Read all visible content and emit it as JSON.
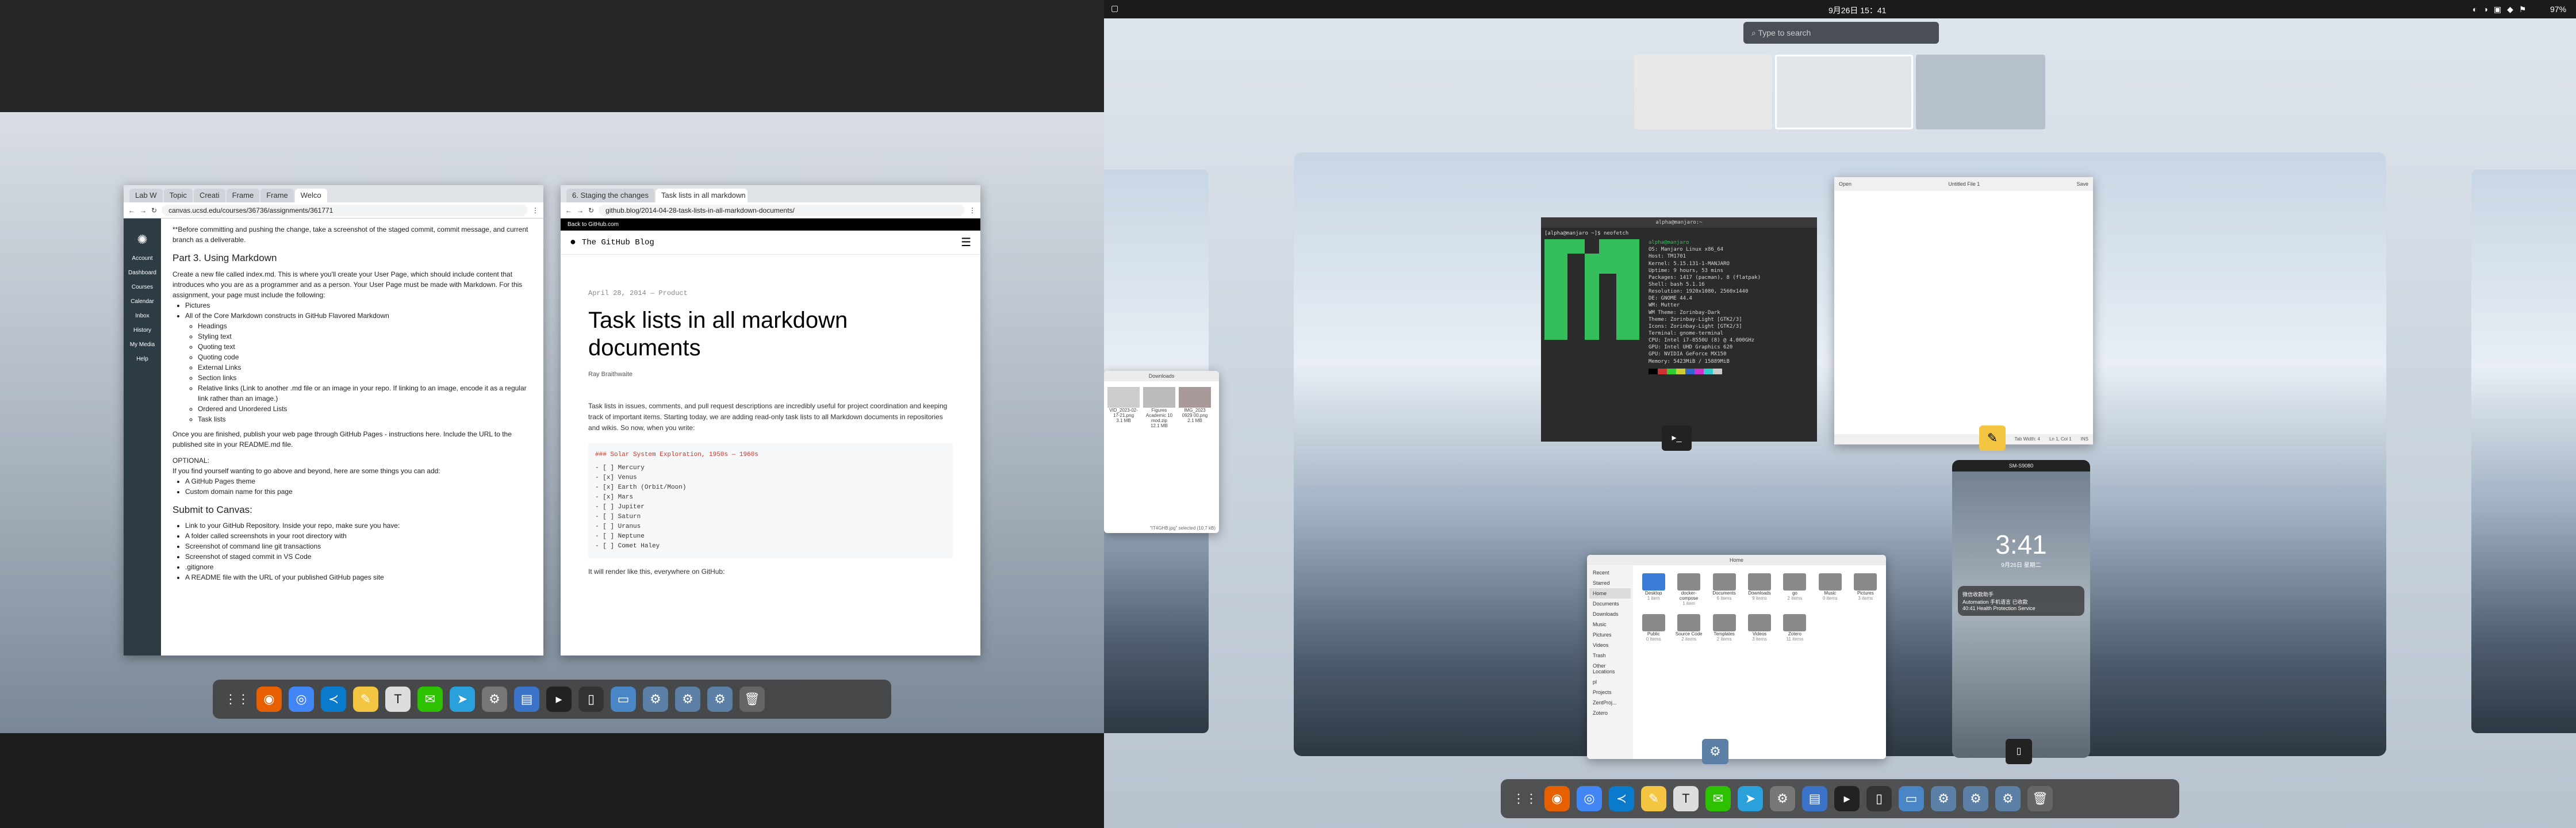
{
  "left_monitor": {
    "canvas_window": {
      "tabs": [
        "Lab W",
        "Topic",
        "Creati",
        "Frame",
        "Frame",
        "Welco"
      ],
      "url": "canvas.ucsd.edu/courses/36736/assignments/361771",
      "sidebar": [
        "Account",
        "Dashboard",
        "Courses",
        "Calendar",
        "Inbox",
        "History",
        "My Media",
        "Help"
      ],
      "intro": "**Before committing and pushing the change, take a screenshot of the staged commit, commit message, and current branch as a deliverable.",
      "heading": "Part 3. Using Markdown",
      "para": "Create a new file called index.md. This is where you'll create your User Page, which should include content that introduces who you are as a programmer and as a person. Your User Page must be made with Markdown. For this assignment, your page must include the following:",
      "items": [
        "Pictures",
        "All of the Core Markdown constructs in GitHub Flavored Markdown"
      ],
      "subitems": [
        "Headings",
        "Styling text",
        "Quoting text",
        "Quoting code",
        "External Links",
        "Section links",
        "Relative links (Link to another .md file or an image in your repo. If linking to an image, encode it as a regular link rather than an image.)",
        "Ordered and Unordered Lists",
        "Task lists"
      ],
      "publish": "Once you are finished, publish your web page through GitHub Pages - instructions here. Include the URL to the published site in your README.md file.",
      "optional_title": "OPTIONAL:",
      "optional_text": "If you find yourself wanting to go above and beyond, here are some things you can add:",
      "optional_items": [
        "A GitHub Pages theme",
        "Custom domain name for this page"
      ],
      "submit_heading": "Submit to Canvas:",
      "submit_items": [
        "Link to your GitHub Repository. Inside your repo, make sure you have:",
        "A folder called screenshots in your root directory with",
        "Screenshot of command line git transactions",
        "Screenshot of staged commit in VS Code",
        ".gitignore",
        "A README file with the URL of your published GitHub pages site"
      ]
    },
    "blog_window": {
      "tabs": [
        "6. Staging the changes",
        "Task lists in all markdown"
      ],
      "url": "github.blog/2014-04-28-task-lists-in-all-markdown-documents/",
      "back_link": "Back to GitHub.com",
      "blog_name": "The GitHub Blog",
      "meta": "April 28, 2014 — Product",
      "title": "Task lists in all markdown documents",
      "author": "Ray Braithwaite",
      "body": "Task lists in issues, comments, and pull request descriptions are incredibly useful for project coordination and keeping track of important items. Starting today, we are adding read-only task lists to all Markdown documents in repositories and wikis. So now, when you write:",
      "code_title": "### Solar System Exploration, 1950s — 1960s",
      "code_lines": [
        "- [ ] Mercury",
        "- [x] Venus",
        "- [x] Earth (Orbit/Moon)",
        "- [x] Mars",
        "- [ ] Jupiter",
        "- [ ] Saturn",
        "- [ ] Uranus",
        "- [ ] Neptune",
        "- [ ] Comet Haley"
      ],
      "after": "It will render like this, everywhere on GitHub:"
    },
    "dock_icons": [
      "apps-grid-icon",
      "firefox-icon",
      "chrome-icon",
      "vscode-icon",
      "notes-icon",
      "text-editor-icon",
      "wechat-icon",
      "telegram-icon",
      "settings-icon",
      "document-icon",
      "terminal-icon",
      "phone-icon",
      "screen-icon",
      "gear-icon",
      "gear-icon",
      "gear-icon",
      "trash-icon"
    ]
  },
  "right_monitor": {
    "clock": "9月26日 15：41",
    "battery": "97%",
    "search_placeholder": "Type to search",
    "terminal": {
      "title": "alpha@manjaro:~",
      "prompt": "[alpha@manjaro ~]$ neofetch",
      "user": "alpha@manjaro",
      "lines": [
        "OS: Manjaro Linux x86_64",
        "Host: TM1701",
        "Kernel: 5.15.131-1-MANJARO",
        "Uptime: 9 hours, 53 mins",
        "Packages: 1417 (pacman), 8 (flatpak)",
        "Shell: bash 5.1.16",
        "Resolution: 1920x1080, 2560x1440",
        "DE: GNOME 44.4",
        "WM: Mutter",
        "WM Theme: Zorinbay-Dark",
        "Theme: Zorinbay-Light [GTK2/3]",
        "Icons: Zorinbay-Light [GTK2/3]",
        "Terminal: gnome-terminal",
        "CPU: Intel i7-8550U (8) @ 4.000GHz",
        "GPU: Intel UHD Graphics 620",
        "GPU: NVIDIA GeForce MX150",
        "Memory: 5423MiB / 15889MiB"
      ]
    },
    "editor_title": "Untitled File 1",
    "editor_open": "Open",
    "editor_save": "Save",
    "editor_status": "Tab Width: 4",
    "editor_pos": "Ln 1, Col 1",
    "editor_ins": "INS",
    "phone": {
      "title": "SM-S9080",
      "time": "3:41",
      "date": "9月26日 星期二",
      "notif_title": "微信收款助手",
      "notif_body": "Automation 手机语言 已收款",
      "notif_extra": "40:41 Health Protection Service"
    },
    "files": {
      "path": "Home",
      "sidebar": [
        "Recent",
        "Starred",
        "Home",
        "Documents",
        "Downloads",
        "Music",
        "Pictures",
        "Videos",
        "Trash",
        "Other Locations"
      ],
      "folders": [
        {
          "name": "Desktop",
          "count": "1 item"
        },
        {
          "name": "docker-compose",
          "count": "1 item"
        },
        {
          "name": "Documents",
          "count": "6 items"
        },
        {
          "name": "Downloads",
          "count": "9 items"
        },
        {
          "name": "go",
          "count": "2 items"
        },
        {
          "name": "Music",
          "count": "0 items"
        },
        {
          "name": "Pictures",
          "count": "3 items"
        },
        {
          "name": "Public",
          "count": "0 items"
        },
        {
          "name": "Source Code",
          "count": "2 items"
        },
        {
          "name": "Templates",
          "count": "2 items"
        },
        {
          "name": "Videos",
          "count": "3 items"
        },
        {
          "name": "Zotero",
          "count": "11 items"
        }
      ],
      "bookmarks": [
        "pl",
        "Projects",
        "ZentProj...",
        "Zotero"
      ]
    },
    "downloads": {
      "title": "Downloads",
      "files": [
        {
          "name": "VID_2023-02-17-21.png",
          "size": "3.1 MB"
        },
        {
          "name": "Figures Academic 10 mod.zip",
          "size": "12.1 MB"
        },
        {
          "name": "IMG_2023 0929 00.png",
          "size": "2.1 MB"
        }
      ],
      "status": "\"IT4GHB.jpg\" selected (10.7 kB)"
    },
    "dock_icons": [
      "apps-grid-icon",
      "firefox-icon",
      "chrome-icon",
      "vscode-icon",
      "notes-icon",
      "text-editor-icon",
      "wechat-icon",
      "telegram-icon",
      "settings-icon",
      "document-icon",
      "terminal-icon",
      "phone-icon",
      "screen-icon",
      "gear-icon",
      "gear-icon",
      "gear-icon",
      "trash-icon"
    ]
  }
}
